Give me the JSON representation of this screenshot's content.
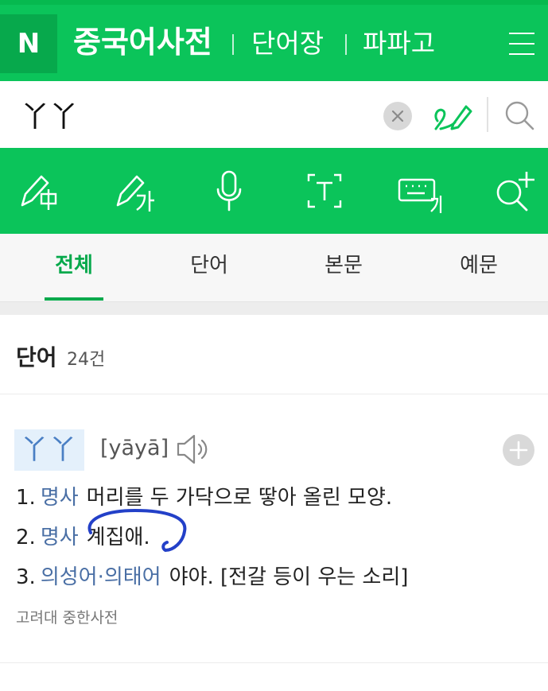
{
  "header": {
    "logo": "N",
    "title": "중국어사전",
    "links": [
      "단어장",
      "파파고"
    ]
  },
  "search": {
    "query": "丫丫"
  },
  "tabs": [
    "전체",
    "단어",
    "본문",
    "예문"
  ],
  "section": {
    "title": "단어",
    "count": "24건"
  },
  "entry": {
    "headword": "丫丫",
    "pinyin": "[yāyā]",
    "definitions": [
      {
        "num": "1.",
        "pos": "명사",
        "text": "머리를 두 가닥으로 땋아 올린 모양."
      },
      {
        "num": "2.",
        "pos": "명사",
        "text": "계집애."
      },
      {
        "num": "3.",
        "pos": "의성어·의태어",
        "text": "야야. [전갈 등이 우는 소리]"
      }
    ],
    "source": "고려대 중한사전"
  },
  "colors": {
    "brand_green": "#0bc45a",
    "logo_green": "#07a94c",
    "pos_blue": "#4a6fa5",
    "ink_blue": "#2340c8"
  }
}
